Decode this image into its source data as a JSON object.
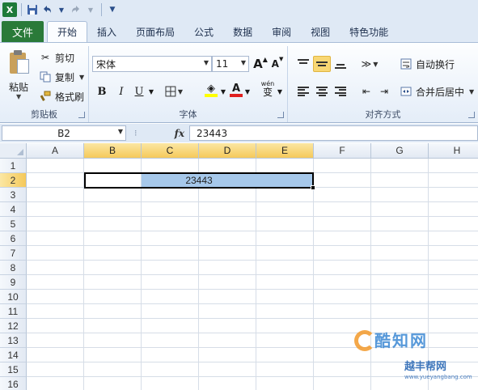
{
  "quick_access": {
    "app_icon_letter": "X",
    "icons": [
      "excel-logo-icon",
      "save-icon",
      "undo-icon",
      "redo-icon",
      "customize-toolbar-icon"
    ]
  },
  "ribbon_tabs": [
    {
      "label": "文件",
      "kind": "file"
    },
    {
      "label": "开始",
      "active": true
    },
    {
      "label": "插入"
    },
    {
      "label": "页面布局"
    },
    {
      "label": "公式"
    },
    {
      "label": "数据"
    },
    {
      "label": "审阅"
    },
    {
      "label": "视图"
    },
    {
      "label": "特色功能"
    }
  ],
  "clipboard": {
    "paste": "粘贴",
    "cut": "剪切",
    "copy": "复制",
    "format_painter": "格式刷",
    "group_label": "剪贴板"
  },
  "font": {
    "name": "宋体",
    "size": "11",
    "bold": "B",
    "italic": "I",
    "underline": "U",
    "grow": "A",
    "shrink": "A",
    "font_color_letter": "A",
    "phonetic": "wén",
    "phonetic_char": "变",
    "group_label": "字体"
  },
  "alignment": {
    "wrap_text": "自动换行",
    "merge_center": "合并后居中",
    "group_label": "对齐方式"
  },
  "formula_bar": {
    "name_box": "B2",
    "fx": "fx",
    "value": "23443"
  },
  "grid": {
    "columns": [
      "A",
      "B",
      "C",
      "D",
      "E",
      "F",
      "G",
      "H"
    ],
    "rows": [
      "1",
      "2",
      "3",
      "4",
      "5",
      "6",
      "7",
      "8",
      "9",
      "10",
      "11",
      "12",
      "13",
      "14",
      "15",
      "16"
    ],
    "selected_columns": [
      "B",
      "C",
      "D",
      "E"
    ],
    "selected_row": "2",
    "merged_value": "23443"
  },
  "watermark": {
    "main": "酷知网",
    "sub": "越丰帮网",
    "url": "www.yueyangbang.com"
  },
  "colors": {
    "file_tab": "#2a7a39",
    "selection_header": "#f5c95b",
    "merged_highlight": "#a6c8ea"
  }
}
